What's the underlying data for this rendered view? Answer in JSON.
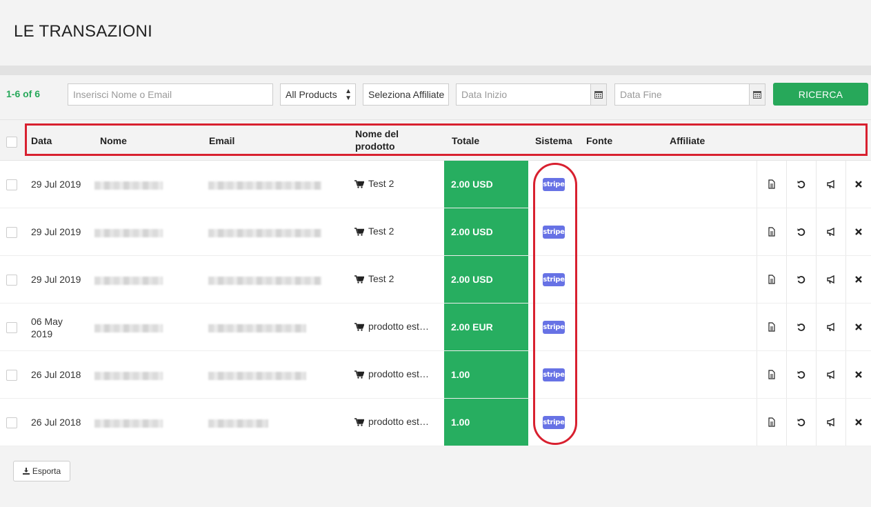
{
  "page": {
    "title": "LE TRANSAZIONI"
  },
  "filters": {
    "count": "1-6 of 6",
    "name_email_placeholder": "Inserisci Nome o Email",
    "products_selected": "All Products",
    "affiliate_selected": "Seleziona Affiliate",
    "start_date_placeholder": "Data Inizio",
    "end_date_placeholder": "Data Fine",
    "search_label": "RICERCA"
  },
  "table": {
    "headers": {
      "date": "Data",
      "name": "Nome",
      "email": "Email",
      "product_line1": "Nome del",
      "product_line2": "prodotto",
      "total": "Totale",
      "system": "Sistema",
      "source": "Fonte",
      "affiliate": "Affiliate"
    },
    "rows": [
      {
        "date_line1": "29 Jul 2019",
        "date_line2": "",
        "product": "Test 2",
        "total": "2.00 USD",
        "system": "stripe"
      },
      {
        "date_line1": "29 Jul 2019",
        "date_line2": "",
        "product": "Test 2",
        "total": "2.00 USD",
        "system": "stripe"
      },
      {
        "date_line1": "29 Jul 2019",
        "date_line2": "",
        "product": "Test 2",
        "total": "2.00 USD",
        "system": "stripe"
      },
      {
        "date_line1": "06 May",
        "date_line2": "2019",
        "product": "prodotto est…",
        "total": "2.00 EUR",
        "system": "stripe"
      },
      {
        "date_line1": "26 Jul 2018",
        "date_line2": "",
        "product": "prodotto est…",
        "total": "1.00",
        "system": "stripe"
      },
      {
        "date_line1": "26 Jul 2018",
        "date_line2": "",
        "product": "prodotto est…",
        "total": "1.00",
        "system": "stripe"
      }
    ]
  },
  "export_label": "Esporta",
  "colors": {
    "accent_green": "#27ae60",
    "stripe_purple": "#6772e5",
    "annotation_red": "#d8202f"
  },
  "icons": [
    "calendar-icon",
    "cart-icon",
    "document-icon",
    "refund-icon",
    "megaphone-icon",
    "close-icon",
    "download-icon"
  ]
}
